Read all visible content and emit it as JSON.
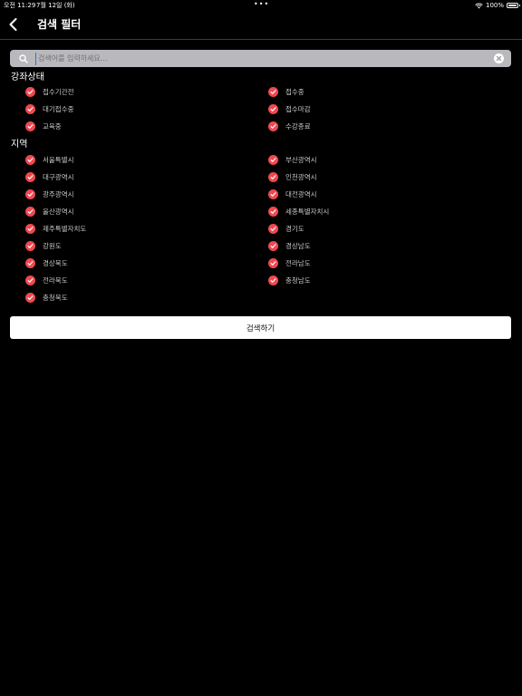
{
  "status_bar": {
    "time": "오전 11:29",
    "date": "7월 12일 (화)",
    "battery": "100%"
  },
  "header": {
    "title": "검색 필터"
  },
  "search": {
    "placeholder": "검색어를 입력하세요..."
  },
  "sections": {
    "status": {
      "title": "강좌상태",
      "items": [
        "접수기간전",
        "접수중",
        "대기접수중",
        "접수마감",
        "교육중",
        "수강종료"
      ]
    },
    "region": {
      "title": "지역",
      "items": [
        "서울특별시",
        "부산광역시",
        "대구광역시",
        "인천광역시",
        "광주광역시",
        "대전광역시",
        "울산광역시",
        "세종특별자치시",
        "제주특별자치도",
        "경기도",
        "강원도",
        "경상남도",
        "경상북도",
        "전라남도",
        "전라북도",
        "충청남도",
        "충청북도"
      ]
    }
  },
  "submit_label": "검색하기",
  "colors": {
    "check": "#f0484f",
    "background": "#000000",
    "search_bg": "#b9b9bd"
  }
}
